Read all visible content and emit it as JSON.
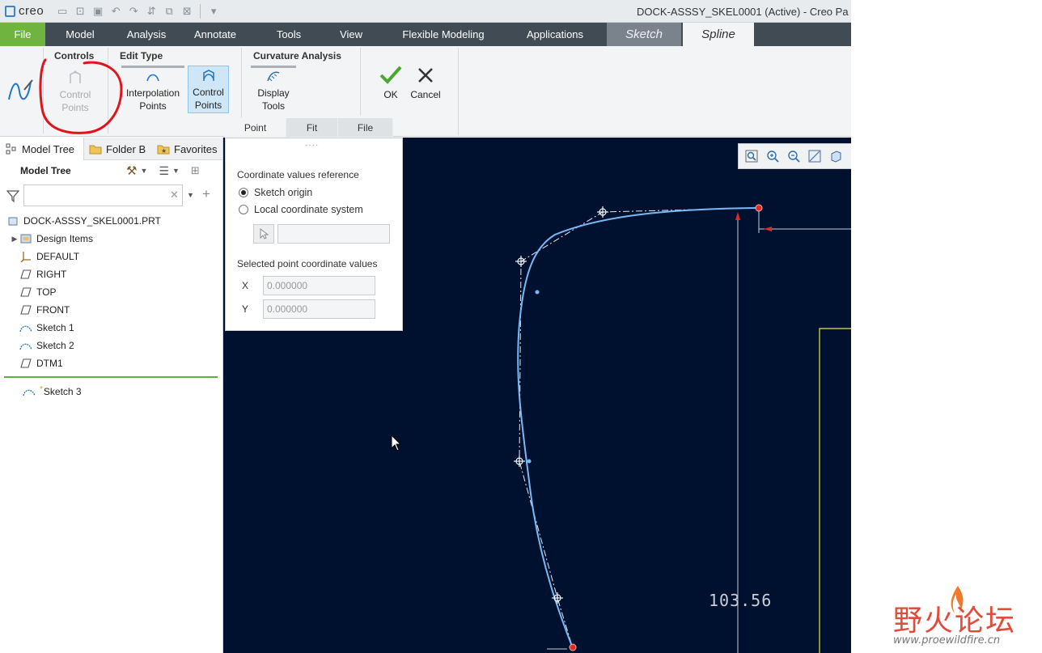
{
  "app": {
    "logo": "creo",
    "window_title": "DOCK-ASSSY_SKEL0001 (Active) - Creo Pa"
  },
  "ribbon_tabs": [
    "File",
    "Model",
    "Analysis",
    "Annotate",
    "Tools",
    "View",
    "Flexible Modeling",
    "Applications",
    "Sketch",
    "Spline"
  ],
  "ribbon": {
    "controls": {
      "title": "Controls",
      "control_points": [
        "Control",
        "Points"
      ]
    },
    "edit_type": {
      "title": "Edit Type",
      "interpolation": [
        "Interpolation",
        "Points"
      ],
      "control": [
        "Control",
        "Points"
      ]
    },
    "curvature": {
      "title": "Curvature Analysis",
      "display_tools": [
        "Display",
        "Tools"
      ]
    },
    "ok": "OK",
    "cancel": "Cancel",
    "subtabs": [
      "Point",
      "Fit",
      "File"
    ]
  },
  "navigator": {
    "tabs": [
      "Model Tree",
      "Folder B",
      "Favorites"
    ],
    "header": "Model Tree",
    "search_value": "",
    "items": [
      {
        "label": "DOCK-ASSSY_SKEL0001.PRT",
        "icon": "part-icon"
      },
      {
        "label": "Design Items",
        "icon": "design-items-icon"
      },
      {
        "label": "DEFAULT",
        "icon": "csys-icon"
      },
      {
        "label": "RIGHT",
        "icon": "datum-plane-icon"
      },
      {
        "label": "TOP",
        "icon": "datum-plane-icon"
      },
      {
        "label": "FRONT",
        "icon": "datum-plane-icon"
      },
      {
        "label": "Sketch 1",
        "icon": "sketch-icon"
      },
      {
        "label": "Sketch 2",
        "icon": "sketch-icon"
      },
      {
        "label": "DTM1",
        "icon": "datum-plane-icon"
      }
    ],
    "active_item": {
      "label": "Sketch 3",
      "icon": "sketch-icon"
    }
  },
  "point_panel": {
    "ref_label": "Coordinate values reference",
    "option_origin": "Sketch origin",
    "option_local": "Local coordinate system",
    "selected_label": "Selected point coordinate values",
    "x_label": "X",
    "y_label": "Y",
    "x_value": "0.000000",
    "y_value": "0.000000"
  },
  "graphics": {
    "dimension": "103.56"
  },
  "watermark": {
    "text": "野火论坛",
    "url": "www.proewildfire.cn"
  },
  "colors": {
    "file_tab": "#6fb43f",
    "tab_bar": "#414b54",
    "canvas": "#00112f",
    "curve": "#7ab8f5",
    "annotation": "#e0151b"
  }
}
